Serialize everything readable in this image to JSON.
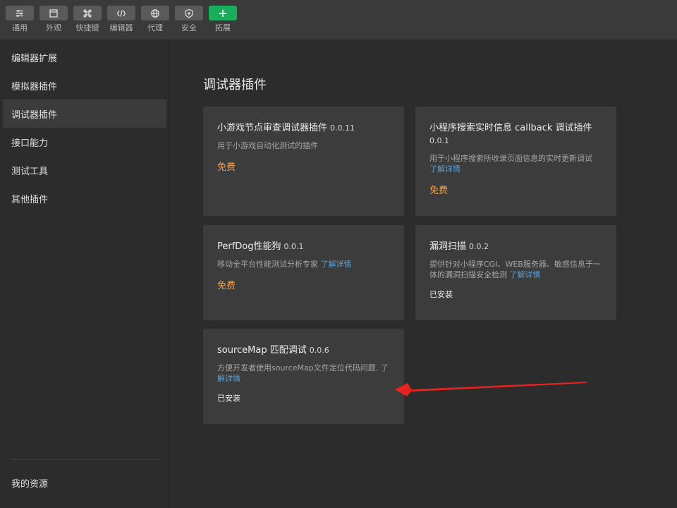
{
  "toolbar": {
    "items": [
      {
        "label": "通用",
        "icon": "sliders-icon"
      },
      {
        "label": "外观",
        "icon": "window-icon"
      },
      {
        "label": "快捷键",
        "icon": "command-icon"
      },
      {
        "label": "编辑器",
        "icon": "code-icon"
      },
      {
        "label": "代理",
        "icon": "globe-icon"
      },
      {
        "label": "安全",
        "icon": "shield-icon"
      },
      {
        "label": "拓展",
        "icon": "plus-icon"
      }
    ],
    "accent": "#1aad5c"
  },
  "sidebar": {
    "items": [
      {
        "label": "编辑器扩展"
      },
      {
        "label": "模拟器插件"
      },
      {
        "label": "调试器插件",
        "active": true
      },
      {
        "label": "接口能力"
      },
      {
        "label": "测试工具"
      },
      {
        "label": "其他插件"
      }
    ],
    "footer": "我的资源"
  },
  "main": {
    "title": "调试器插件",
    "cards": [
      {
        "title": "小游戏节点审查调试器插件",
        "version": "0.0.11",
        "desc": "用于小游戏自动化测试的插件",
        "more": "",
        "status": "免费"
      },
      {
        "title": "小程序搜索实时信息 callback 调试插件",
        "version": "0.0.1",
        "desc": "用于小程序搜索所收录页面信息的实时更新调试",
        "more": "了解详情",
        "status": "免费"
      },
      {
        "title": "PerfDog性能狗",
        "version": "0.0.1",
        "desc": "移动全平台性能测试分析专家",
        "more": "了解详情",
        "status": "免费"
      },
      {
        "title": "漏洞扫描",
        "version": "0.0.2",
        "desc": "提供针对小程序CGI、WEB服务器、敏感信息于一体的漏洞扫描安全检测",
        "more": "了解详情",
        "status": "已安装"
      },
      {
        "title": "sourceMap 匹配调试",
        "version": "0.0.6",
        "desc": "方便开发者使用sourceMap文件定位代码问题.",
        "more": "了解详情",
        "status": "已安装"
      }
    ],
    "price_color": "#f4a04a",
    "link_color": "#5c9fd6",
    "annotation_arrow_color": "#e8231f"
  }
}
